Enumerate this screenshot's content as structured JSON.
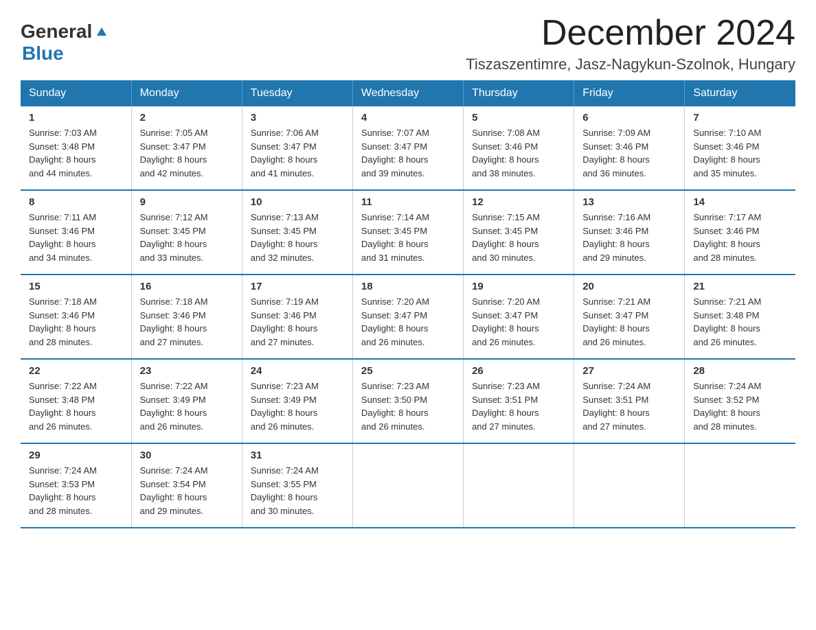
{
  "logo": {
    "general": "General",
    "blue": "Blue"
  },
  "title": "December 2024",
  "location": "Tiszaszentimre, Jasz-Nagykun-Szolnok, Hungary",
  "days_of_week": [
    "Sunday",
    "Monday",
    "Tuesday",
    "Wednesday",
    "Thursday",
    "Friday",
    "Saturday"
  ],
  "weeks": [
    [
      {
        "day": "1",
        "sunrise": "7:03 AM",
        "sunset": "3:48 PM",
        "daylight": "8 hours and 44 minutes."
      },
      {
        "day": "2",
        "sunrise": "7:05 AM",
        "sunset": "3:47 PM",
        "daylight": "8 hours and 42 minutes."
      },
      {
        "day": "3",
        "sunrise": "7:06 AM",
        "sunset": "3:47 PM",
        "daylight": "8 hours and 41 minutes."
      },
      {
        "day": "4",
        "sunrise": "7:07 AM",
        "sunset": "3:47 PM",
        "daylight": "8 hours and 39 minutes."
      },
      {
        "day": "5",
        "sunrise": "7:08 AM",
        "sunset": "3:46 PM",
        "daylight": "8 hours and 38 minutes."
      },
      {
        "day": "6",
        "sunrise": "7:09 AM",
        "sunset": "3:46 PM",
        "daylight": "8 hours and 36 minutes."
      },
      {
        "day": "7",
        "sunrise": "7:10 AM",
        "sunset": "3:46 PM",
        "daylight": "8 hours and 35 minutes."
      }
    ],
    [
      {
        "day": "8",
        "sunrise": "7:11 AM",
        "sunset": "3:46 PM",
        "daylight": "8 hours and 34 minutes."
      },
      {
        "day": "9",
        "sunrise": "7:12 AM",
        "sunset": "3:45 PM",
        "daylight": "8 hours and 33 minutes."
      },
      {
        "day": "10",
        "sunrise": "7:13 AM",
        "sunset": "3:45 PM",
        "daylight": "8 hours and 32 minutes."
      },
      {
        "day": "11",
        "sunrise": "7:14 AM",
        "sunset": "3:45 PM",
        "daylight": "8 hours and 31 minutes."
      },
      {
        "day": "12",
        "sunrise": "7:15 AM",
        "sunset": "3:45 PM",
        "daylight": "8 hours and 30 minutes."
      },
      {
        "day": "13",
        "sunrise": "7:16 AM",
        "sunset": "3:46 PM",
        "daylight": "8 hours and 29 minutes."
      },
      {
        "day": "14",
        "sunrise": "7:17 AM",
        "sunset": "3:46 PM",
        "daylight": "8 hours and 28 minutes."
      }
    ],
    [
      {
        "day": "15",
        "sunrise": "7:18 AM",
        "sunset": "3:46 PM",
        "daylight": "8 hours and 28 minutes."
      },
      {
        "day": "16",
        "sunrise": "7:18 AM",
        "sunset": "3:46 PM",
        "daylight": "8 hours and 27 minutes."
      },
      {
        "day": "17",
        "sunrise": "7:19 AM",
        "sunset": "3:46 PM",
        "daylight": "8 hours and 27 minutes."
      },
      {
        "day": "18",
        "sunrise": "7:20 AM",
        "sunset": "3:47 PM",
        "daylight": "8 hours and 26 minutes."
      },
      {
        "day": "19",
        "sunrise": "7:20 AM",
        "sunset": "3:47 PM",
        "daylight": "8 hours and 26 minutes."
      },
      {
        "day": "20",
        "sunrise": "7:21 AM",
        "sunset": "3:47 PM",
        "daylight": "8 hours and 26 minutes."
      },
      {
        "day": "21",
        "sunrise": "7:21 AM",
        "sunset": "3:48 PM",
        "daylight": "8 hours and 26 minutes."
      }
    ],
    [
      {
        "day": "22",
        "sunrise": "7:22 AM",
        "sunset": "3:48 PM",
        "daylight": "8 hours and 26 minutes."
      },
      {
        "day": "23",
        "sunrise": "7:22 AM",
        "sunset": "3:49 PM",
        "daylight": "8 hours and 26 minutes."
      },
      {
        "day": "24",
        "sunrise": "7:23 AM",
        "sunset": "3:49 PM",
        "daylight": "8 hours and 26 minutes."
      },
      {
        "day": "25",
        "sunrise": "7:23 AM",
        "sunset": "3:50 PM",
        "daylight": "8 hours and 26 minutes."
      },
      {
        "day": "26",
        "sunrise": "7:23 AM",
        "sunset": "3:51 PM",
        "daylight": "8 hours and 27 minutes."
      },
      {
        "day": "27",
        "sunrise": "7:24 AM",
        "sunset": "3:51 PM",
        "daylight": "8 hours and 27 minutes."
      },
      {
        "day": "28",
        "sunrise": "7:24 AM",
        "sunset": "3:52 PM",
        "daylight": "8 hours and 28 minutes."
      }
    ],
    [
      {
        "day": "29",
        "sunrise": "7:24 AM",
        "sunset": "3:53 PM",
        "daylight": "8 hours and 28 minutes."
      },
      {
        "day": "30",
        "sunrise": "7:24 AM",
        "sunset": "3:54 PM",
        "daylight": "8 hours and 29 minutes."
      },
      {
        "day": "31",
        "sunrise": "7:24 AM",
        "sunset": "3:55 PM",
        "daylight": "8 hours and 30 minutes."
      },
      null,
      null,
      null,
      null
    ]
  ],
  "labels": {
    "sunrise": "Sunrise: ",
    "sunset": "Sunset: ",
    "daylight": "Daylight: "
  }
}
